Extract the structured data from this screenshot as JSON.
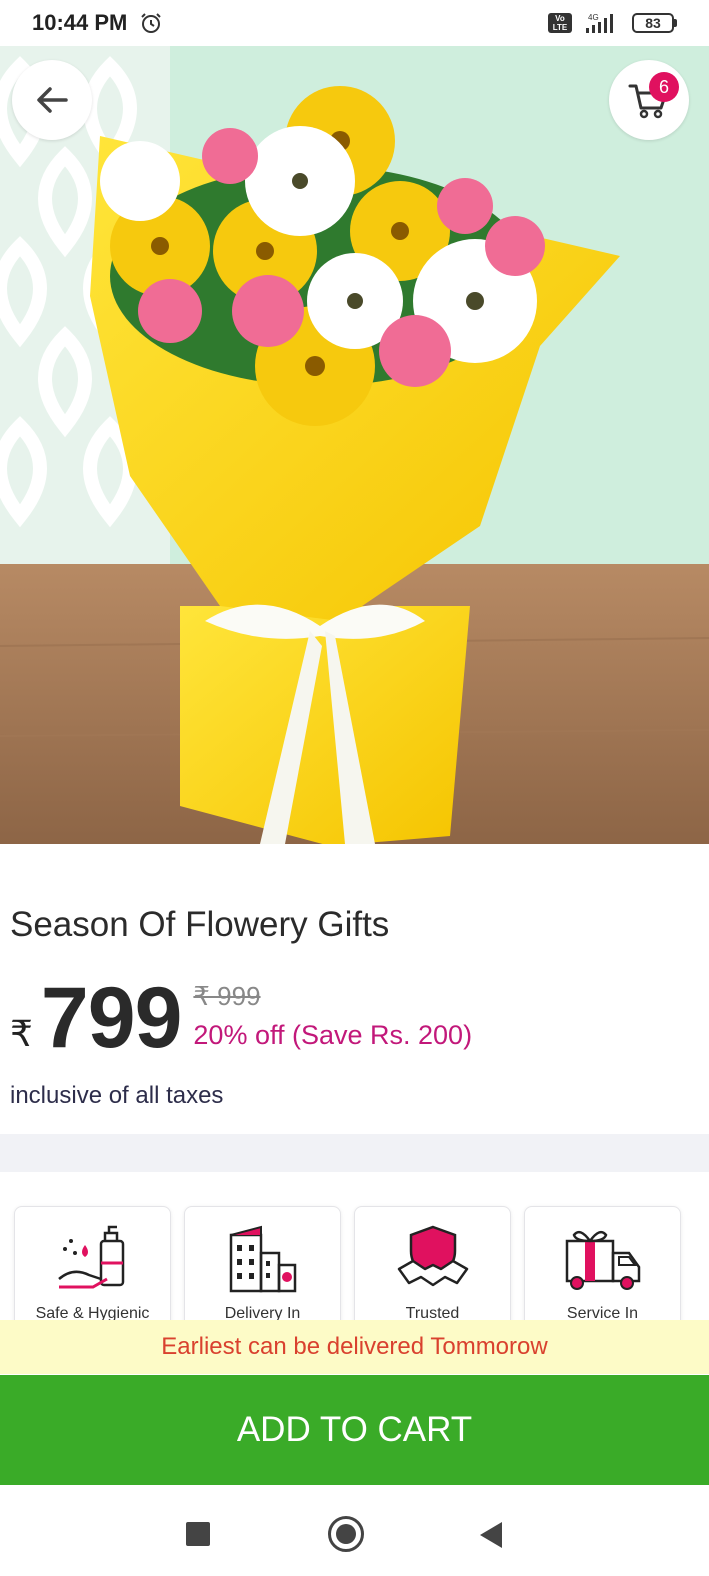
{
  "status_bar": {
    "time": "10:44 PM",
    "alarm_icon": "alarm-clock-icon",
    "volte_label": "Vo LTE",
    "network_label": "4G",
    "battery_level": "83"
  },
  "header": {
    "back_icon": "arrow-left-icon",
    "cart_icon": "shopping-cart-icon",
    "cart_count": "6"
  },
  "hero_image": {
    "description_icon": "flower-bouquet-image"
  },
  "product": {
    "title": "Season Of Flowery Gifts",
    "currency_symbol": "₹",
    "price": "799",
    "mrp": "₹ 999",
    "discount_text": "20% off (Save Rs. 200)",
    "tax_note": "inclusive of all taxes"
  },
  "features": [
    {
      "label": "Safe & Hygienic",
      "icon": "sanitizer-hand-icon"
    },
    {
      "label": "Delivery In",
      "icon": "city-buildings-icon"
    },
    {
      "label": "Trusted",
      "icon": "handshake-shield-icon"
    },
    {
      "label": "Service In",
      "icon": "gift-truck-icon"
    }
  ],
  "delivery": {
    "message": "Earliest can be delivered Tommorow"
  },
  "actions": {
    "add_to_cart_label": "ADD TO CART"
  },
  "colors": {
    "accent_pink": "#e0115f",
    "discount_text": "#c2187a",
    "cta_green": "#3aab28",
    "delivery_bg": "#fdfbc7",
    "delivery_text": "#d9412e"
  }
}
